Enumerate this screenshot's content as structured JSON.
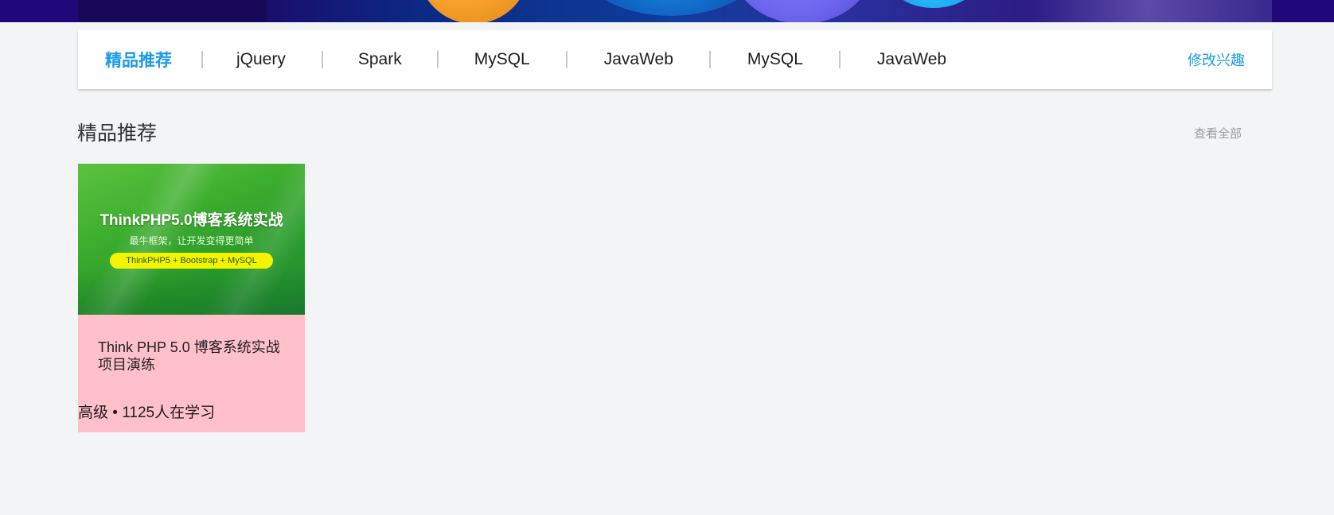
{
  "categories": {
    "items": [
      {
        "label": "精品推荐",
        "active": true
      },
      {
        "label": "jQuery",
        "active": false
      },
      {
        "label": "Spark",
        "active": false
      },
      {
        "label": "MySQL",
        "active": false
      },
      {
        "label": "JavaWeb",
        "active": false
      },
      {
        "label": "MySQL",
        "active": false
      },
      {
        "label": "JavaWeb",
        "active": false
      }
    ],
    "edit_label": "修改兴趣"
  },
  "section": {
    "title": "精品推荐",
    "more_label": "查看全部"
  },
  "courses": [
    {
      "cover_headline": "ThinkPHP5.0博客系统实战",
      "cover_subtitle": "最牛框架，让开发变得更简单",
      "cover_stack": "ThinkPHP5 + Bootstrap + MySQL",
      "title": "Think PHP 5.0 博客系统实战项目演练",
      "level": "高级",
      "separator": "•",
      "learners": "1125人在学习"
    }
  ],
  "colors": {
    "accent": "#1a9ae8",
    "page_background": "#f3f4f6",
    "card_background": "#ffc0cb",
    "banner_background": "#20087a"
  }
}
